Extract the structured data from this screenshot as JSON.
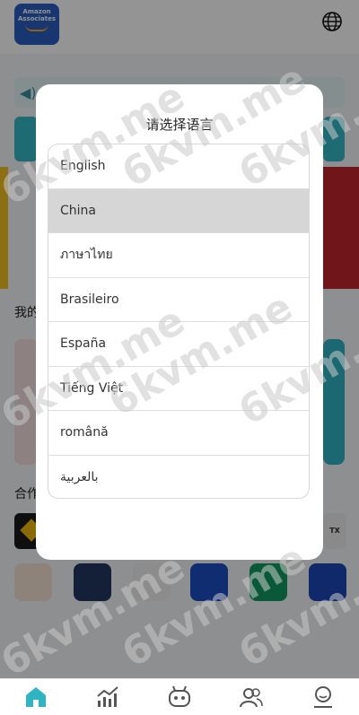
{
  "background": {
    "logo": {
      "line1": "Amazon",
      "line2": "Associates"
    },
    "section_mine": "我的",
    "section_partners": "合作",
    "partner_badge": "TX"
  },
  "modal": {
    "title": "请选择语言",
    "languages": [
      {
        "label": "English"
      },
      {
        "label": "China",
        "selected": true
      },
      {
        "label": "ภาษาไทย"
      },
      {
        "label": "Brasileiro"
      },
      {
        "label": "España"
      },
      {
        "label": "Tiếng Việt"
      },
      {
        "label": "română"
      },
      {
        "label": "بالعربية"
      }
    ]
  },
  "watermark": "6kvm.me",
  "colors": {
    "accent": "#2fb4c6",
    "selected_row": "#d6d6d6"
  },
  "bottom_nav": {
    "icons": [
      "home-icon",
      "chart-icon",
      "robot-icon",
      "team-icon",
      "profile-icon"
    ],
    "active": "home-icon"
  }
}
